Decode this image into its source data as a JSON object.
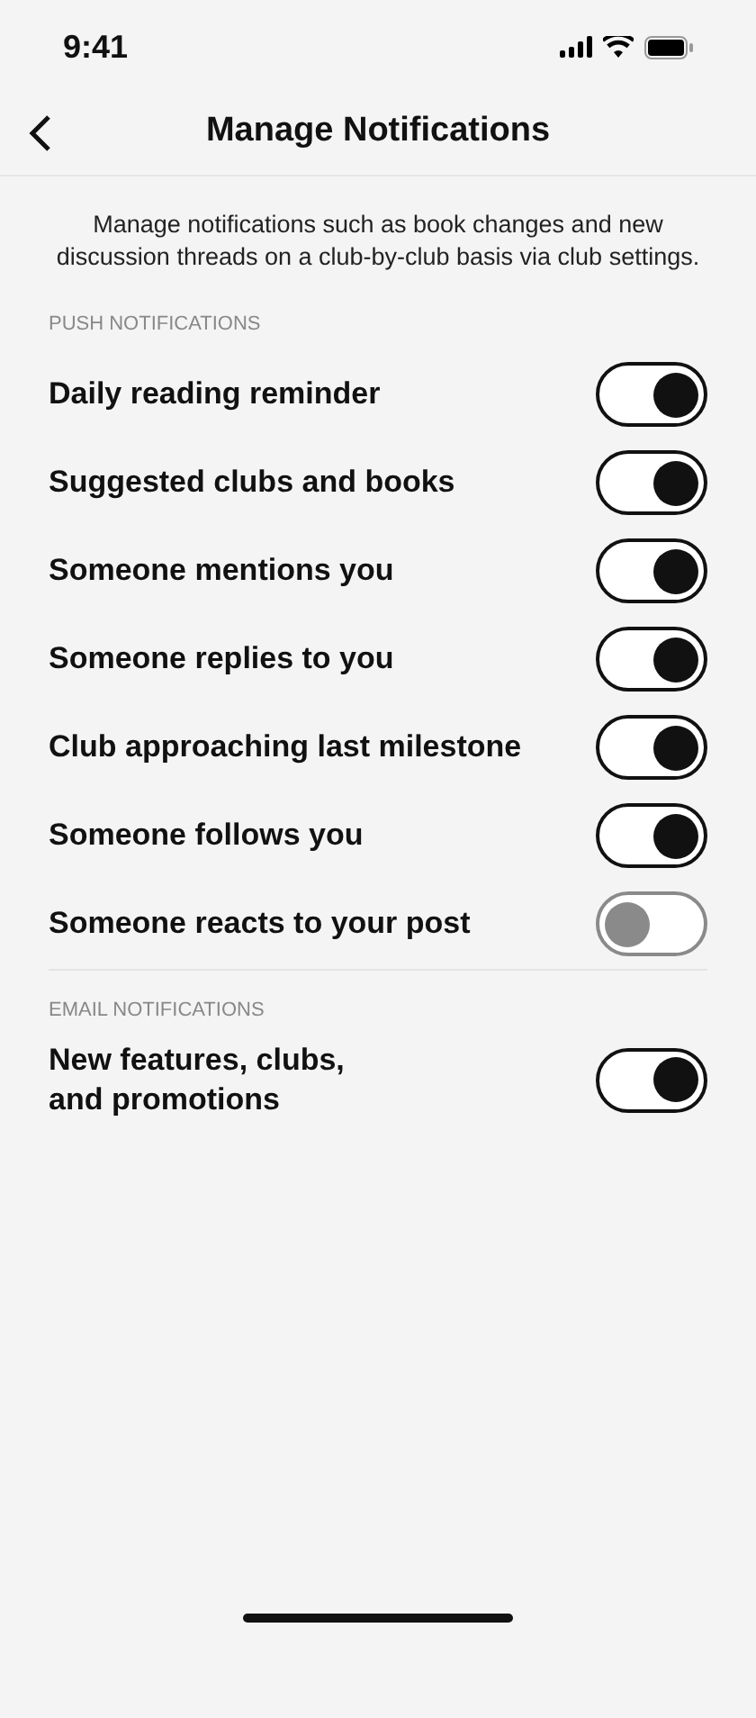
{
  "status_bar": {
    "time": "9:41"
  },
  "header": {
    "title": "Manage Notifications"
  },
  "description": "Manage notifications such as book changes and new discussion threads on a club-by-club basis via club settings.",
  "sections": [
    {
      "title": "PUSH NOTIFICATIONS",
      "items": [
        {
          "label": "Daily reading reminder",
          "on": true
        },
        {
          "label": "Suggested clubs and books",
          "on": true
        },
        {
          "label": "Someone mentions you",
          "on": true
        },
        {
          "label": "Someone replies to you",
          "on": true
        },
        {
          "label": "Club approaching last milestone",
          "on": true
        },
        {
          "label": "Someone follows you",
          "on": true
        },
        {
          "label": "Someone reacts to your post",
          "on": false
        }
      ]
    },
    {
      "title": "EMAIL NOTIFICATIONS",
      "items": [
        {
          "label": "New features, clubs,\nand promotions",
          "on": true
        }
      ]
    }
  ]
}
